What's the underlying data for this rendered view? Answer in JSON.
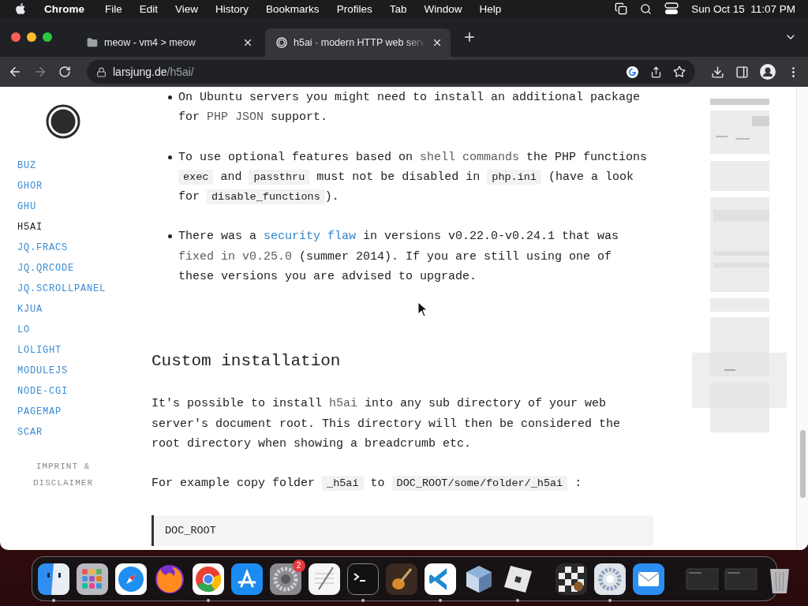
{
  "menubar": {
    "app": "Chrome",
    "menus": [
      "File",
      "Edit",
      "View",
      "History",
      "Bookmarks",
      "Profiles",
      "Tab",
      "Window",
      "Help"
    ],
    "clock": "Sun Oct 15  11:07 PM"
  },
  "tabs": [
    {
      "title": "meow - vm4 > meow",
      "selected": false,
      "kind": "folder"
    },
    {
      "title": "h5ai · modern HTTP web serv",
      "selected": true,
      "kind": "site"
    }
  ],
  "toolbar": {
    "nav_buttons": [
      {
        "kind": "back",
        "disabled": false
      },
      {
        "kind": "forward",
        "disabled": true
      },
      {
        "kind": "reload",
        "disabled": false
      }
    ],
    "address": {
      "host": "larsjung.de",
      "path": "/h5ai/"
    }
  },
  "sidebar": {
    "items": [
      {
        "label": "BUZ",
        "selected": false
      },
      {
        "label": "GHOR",
        "selected": false
      },
      {
        "label": "GHU",
        "selected": false
      },
      {
        "label": "H5AI",
        "selected": true
      },
      {
        "label": "JQ.FRACS",
        "selected": false
      },
      {
        "label": "JQ.QRCODE",
        "selected": false
      },
      {
        "label": "JQ.SCROLLPANEL",
        "selected": false
      },
      {
        "label": "KJUA",
        "selected": false
      },
      {
        "label": "LO",
        "selected": false
      },
      {
        "label": "LOLIGHT",
        "selected": false
      },
      {
        "label": "MODULEJS",
        "selected": false
      },
      {
        "label": "NODE-CGI",
        "selected": false
      },
      {
        "label": "PAGEMAP",
        "selected": false
      },
      {
        "label": "SCAR",
        "selected": false
      }
    ],
    "footer_link": "IMPRINT & DISCLAIMER"
  },
  "content": {
    "bullets": [
      {
        "segments": [
          {
            "kind": "text",
            "text": "On Ubuntu servers you might need to install an additional package for "
          },
          {
            "kind": "term",
            "text": "PHP JSON"
          },
          {
            "kind": "text",
            "text": " support."
          }
        ]
      },
      {
        "segments": [
          {
            "kind": "text",
            "text": "To use optional features based on "
          },
          {
            "kind": "term",
            "text": "shell commands"
          },
          {
            "kind": "text",
            "text": " the PHP functions "
          },
          {
            "kind": "code",
            "text": "exec"
          },
          {
            "kind": "text",
            "text": " and "
          },
          {
            "kind": "code",
            "text": "passthru"
          },
          {
            "kind": "text",
            "text": " must not be disabled in "
          },
          {
            "kind": "code",
            "text": "php.ini"
          },
          {
            "kind": "text",
            "text": " (have a look for "
          },
          {
            "kind": "code",
            "text": "disable_functions"
          },
          {
            "kind": "text",
            "text": ")."
          }
        ]
      },
      {
        "segments": [
          {
            "kind": "text",
            "text": "There was a "
          },
          {
            "kind": "link",
            "text": "security flaw"
          },
          {
            "kind": "text",
            "text": " in versions v0.22.0-v0.24.1 that was "
          },
          {
            "kind": "term",
            "text": "fixed in v0.25.0"
          },
          {
            "kind": "text",
            "text": " (summer 2014). If you are still using one of these versions you are advised to upgrade."
          }
        ]
      }
    ],
    "heading": "Custom installation",
    "paragraphs": [
      {
        "segments": [
          {
            "kind": "text",
            "text": "It's possible to install "
          },
          {
            "kind": "term",
            "text": "h5ai"
          },
          {
            "kind": "text",
            "text": " into any sub directory of your web server's document root. This directory will then be considered the root directory when showing a breadcrumb etc."
          }
        ]
      },
      {
        "segments": [
          {
            "kind": "text",
            "text": "For example copy folder "
          },
          {
            "kind": "code",
            "text": "_h5ai"
          },
          {
            "kind": "text",
            "text": " to "
          },
          {
            "kind": "code",
            "text": "DOC_ROOT/some/folder/_h5ai"
          },
          {
            "kind": "text",
            "text": " :"
          }
        ]
      }
    ],
    "code_block": "DOC_ROOT"
  },
  "dock": {
    "items": [
      {
        "kind": "finder",
        "running": true
      },
      {
        "kind": "launchpad",
        "running": false
      },
      {
        "kind": "safari",
        "running": false
      },
      {
        "kind": "firefox",
        "running": false
      },
      {
        "kind": "chrome",
        "running": true
      },
      {
        "kind": "appstore",
        "running": false
      },
      {
        "kind": "settings",
        "running": false,
        "badge": "2"
      },
      {
        "kind": "textedit",
        "running": false
      },
      {
        "kind": "terminal",
        "running": true
      },
      {
        "kind": "guitar",
        "running": false
      },
      {
        "kind": "vscode",
        "running": true
      },
      {
        "kind": "cube",
        "running": false
      },
      {
        "kind": "roblox",
        "running": true
      },
      {
        "kind": "separator"
      },
      {
        "kind": "chess",
        "running": false
      },
      {
        "kind": "gearapp",
        "running": true
      },
      {
        "kind": "mail",
        "running": false
      },
      {
        "kind": "separator"
      },
      {
        "kind": "window",
        "running": false
      },
      {
        "kind": "window",
        "running": false
      },
      {
        "kind": "trash",
        "running": false
      }
    ]
  }
}
